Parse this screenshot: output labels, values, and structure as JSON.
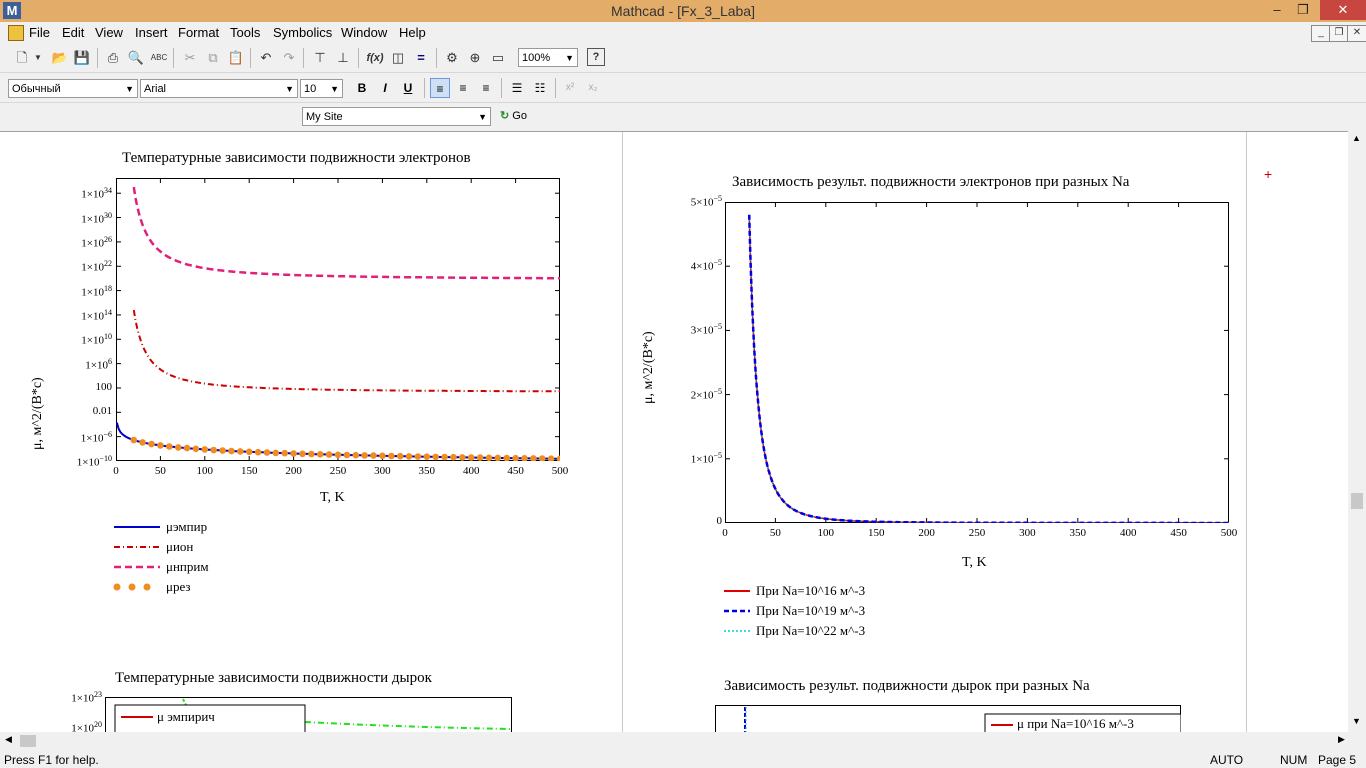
{
  "window": {
    "title": "Mathcad - [Fx_3_Laba]",
    "app_icon": "M"
  },
  "menu": [
    "File",
    "Edit",
    "View",
    "Insert",
    "Format",
    "Tools",
    "Symbolics",
    "Window",
    "Help"
  ],
  "toolbar": {
    "zoom": "100%"
  },
  "format_bar": {
    "style": "Обычный",
    "font": "Arial",
    "size": "10"
  },
  "web_bar": {
    "site": "My Site",
    "go_label": "Go"
  },
  "plot1": {
    "title": "Температурные зависимости подвижности электронов",
    "xlabel": "T, K",
    "ylabel": "μ, м^2/(В*с)",
    "ytick_mant": [
      "1×10",
      "1×10",
      "1×10",
      "1×10",
      "1×10",
      "1×10",
      "1×10",
      "1×10",
      "100",
      "0.01",
      "1×10",
      "1×10"
    ],
    "ytick_exp": [
      "34",
      "30",
      "26",
      "22",
      "18",
      "14",
      "10",
      "6",
      "",
      "",
      "−6",
      "−10"
    ],
    "xticks": [
      "0",
      "50",
      "100",
      "150",
      "200",
      "250",
      "300",
      "350",
      "400",
      "450",
      "500"
    ],
    "legend": [
      "μэмпир",
      "μион",
      "μнприм",
      "μрез"
    ]
  },
  "plot2": {
    "title": "Зависимость результ. подвижности электронов при разных Na",
    "xlabel": "T, K",
    "ylabel": "μ, м^2/(В*с)",
    "ytick_mant": [
      "5×10",
      "4×10",
      "3×10",
      "2×10",
      "1×10",
      "0"
    ],
    "ytick_exp": [
      "−5",
      "−5",
      "−5",
      "−5",
      "−5",
      ""
    ],
    "xticks": [
      "0",
      "50",
      "100",
      "150",
      "200",
      "250",
      "300",
      "350",
      "400",
      "450",
      "500"
    ],
    "legend": [
      "При Na=10^16 м^-3",
      "При Na=10^19 м^-3",
      "При Na=10^22 м^-3"
    ]
  },
  "plot3": {
    "title": "Температурные зависимости подвижности дырок",
    "ytick_mant": [
      "1×10",
      "1×10"
    ],
    "ytick_exp": [
      "23",
      "20"
    ],
    "legend": [
      "μ эмпирич"
    ]
  },
  "plot4": {
    "title": "Зависимость результ. подвижности дырок при разных Na",
    "legend": [
      "μ при Na=10^16 м^-3"
    ]
  },
  "status": {
    "help": "Press F1 for help.",
    "auto": "AUTO",
    "num": "NUM",
    "page": "Page 5"
  },
  "colors": {
    "titlebar": "#e3ad69",
    "emp": "#0000cc",
    "ion": "#cc0000",
    "nprim": "#e0207a",
    "rez": "#f08c20",
    "na16": "#e00000",
    "na19": "#0000e0",
    "na22": "#00c8d8",
    "holes": "#20e020"
  }
}
